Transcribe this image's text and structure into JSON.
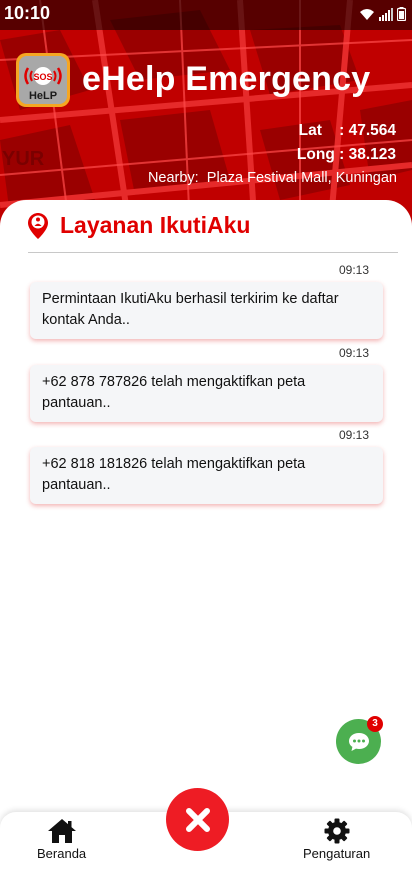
{
  "status_bar": {
    "time": "10:10"
  },
  "header": {
    "app_title": "eHelp Emergency",
    "logo_text_top": "SOS",
    "logo_text_bottom": "HeLP",
    "lat_label": "Lat",
    "lat_value": ": 47.564",
    "long_label": "Long",
    "long_value": ": 38.123",
    "nearby_label": "Nearby:",
    "nearby_value": "Plaza Festival Mall, Kuningan",
    "map_label": "YUR"
  },
  "section": {
    "title": "Layanan IkutiAku"
  },
  "messages": [
    {
      "time": "09:13",
      "text": "Permintaan IkutiAku berhasil terkirim ke daftar kontak Anda.."
    },
    {
      "time": "09:13",
      "text": "+62 878 787826 telah mengaktifkan peta pantauan.."
    },
    {
      "time": "09:13",
      "text": "+62 818 181826 telah mengaktifkan peta pantauan.."
    }
  ],
  "chat": {
    "badge_count": "3"
  },
  "bottom_nav": {
    "home_label": "Beranda",
    "settings_label": "Pengaturan"
  },
  "colors": {
    "accent": "#e00000",
    "chat_fab": "#4caf50",
    "cancel_fab": "#ee1c24",
    "header_bg": "#c40000"
  }
}
